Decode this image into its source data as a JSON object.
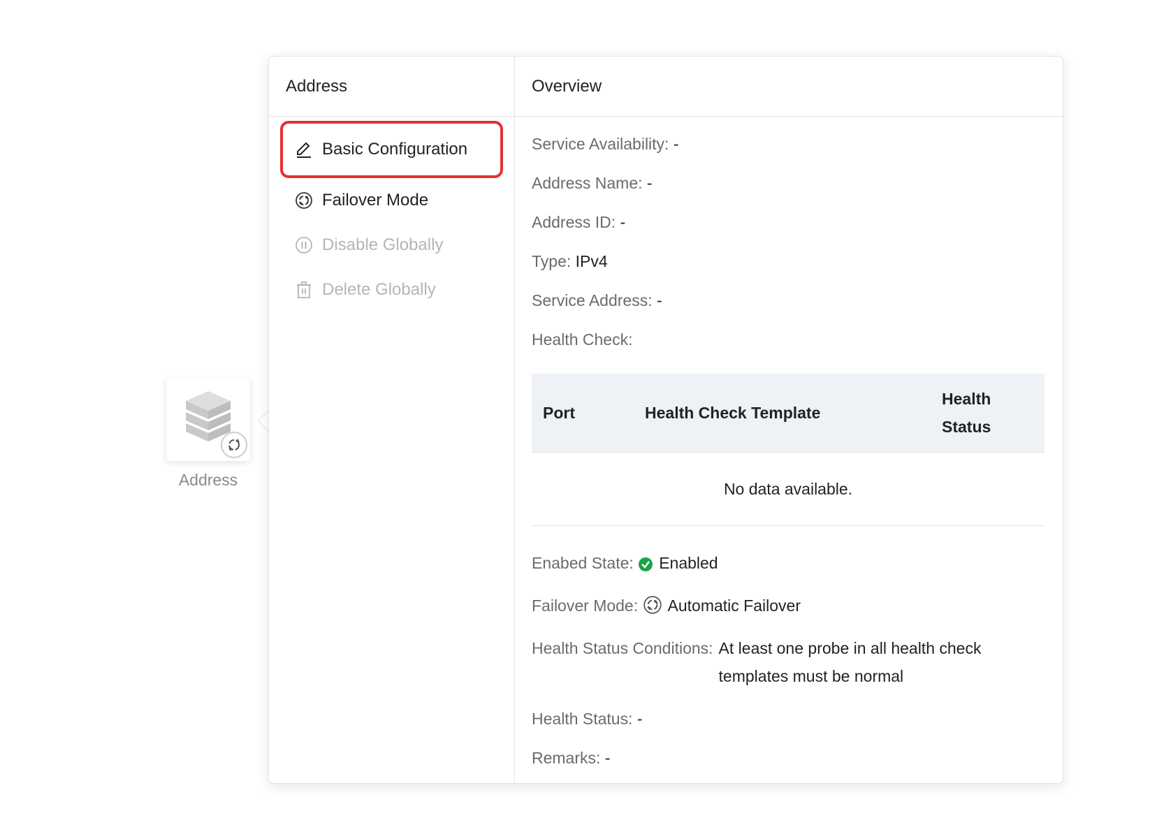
{
  "node": {
    "label": "Address"
  },
  "left_panel": {
    "header": "Address",
    "menu": [
      {
        "label": "Basic Configuration",
        "icon": "edit-icon",
        "state": "active"
      },
      {
        "label": "Failover Mode",
        "icon": "failover-icon",
        "state": "normal"
      },
      {
        "label": "Disable Globally",
        "icon": "pause-icon",
        "state": "disabled"
      },
      {
        "label": "Delete Globally",
        "icon": "trash-icon",
        "state": "disabled"
      }
    ]
  },
  "overview": {
    "header": "Overview",
    "fields": [
      {
        "label": "Service Availability:",
        "value": "-"
      },
      {
        "label": "Address Name:",
        "value": "-"
      },
      {
        "label": "Address ID:",
        "value": "-"
      },
      {
        "label": "Type:",
        "value": "IPv4"
      },
      {
        "label": "Service Address:",
        "value": "-"
      },
      {
        "label": "Health Check:",
        "value": ""
      }
    ],
    "health_table": {
      "columns": [
        "Port",
        "Health Check Template",
        "Health Status"
      ],
      "empty_text": "No data available."
    },
    "fields2": {
      "enabled_state_label": "Enabed State:",
      "enabled_state_value": "Enabled",
      "failover_mode_label": "Failover Mode:",
      "failover_mode_value": "Automatic Failover",
      "conditions_label": "Health Status Conditions:",
      "conditions_value": "At least one probe in all health check templates must be normal",
      "health_status_label": "Health Status:",
      "health_status_value": "-",
      "remarks_label": "Remarks:",
      "remarks_value": "-"
    }
  },
  "colors": {
    "active_border": "#e63030",
    "enabled_green": "#1aa34a",
    "disabled_text": "#b5b5b5"
  }
}
